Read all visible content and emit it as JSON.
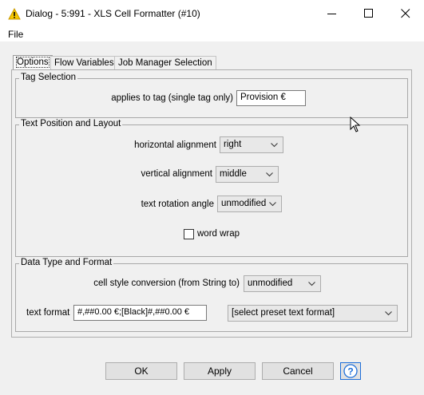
{
  "window": {
    "title": "Dialog - 5:991 - XLS Cell Formatter (#10)",
    "icon": "warning-triangle-icon",
    "controls": [
      "minimize-icon",
      "maximize-icon",
      "close-icon"
    ]
  },
  "menu": {
    "items": [
      "File"
    ]
  },
  "tabs": [
    {
      "label": "Options",
      "selected": true
    },
    {
      "label": "Flow Variables",
      "selected": false
    },
    {
      "label": "Job Manager Selection",
      "selected": false
    }
  ],
  "tag_selection": {
    "legend": "Tag Selection",
    "label": "applies to tag (single tag only)",
    "value": "Provision €"
  },
  "text_position": {
    "legend": "Text Position and Layout",
    "horizontal": {
      "label": "horizontal alignment",
      "value": "right"
    },
    "vertical": {
      "label": "vertical alignment",
      "value": "middle"
    },
    "rotation": {
      "label": "text rotation angle",
      "value": "unmodified"
    },
    "word_wrap": {
      "label": "word wrap",
      "checked": false
    }
  },
  "data_type": {
    "legend": "Data Type and Format",
    "conversion": {
      "label": "cell style conversion (from String to)",
      "value": "unmodified"
    },
    "text_format": {
      "label": "text format",
      "value": "#,##0.00 €;[Black]#,##0.00 €"
    },
    "preset": {
      "value": "[select preset text format]"
    }
  },
  "buttons": {
    "ok": "OK",
    "apply": "Apply",
    "cancel": "Cancel",
    "help_icon": "help-icon"
  },
  "colors": {
    "accent": "#1e6fd9",
    "titlebar": "#ffffff",
    "body": "#f0f0f0"
  }
}
